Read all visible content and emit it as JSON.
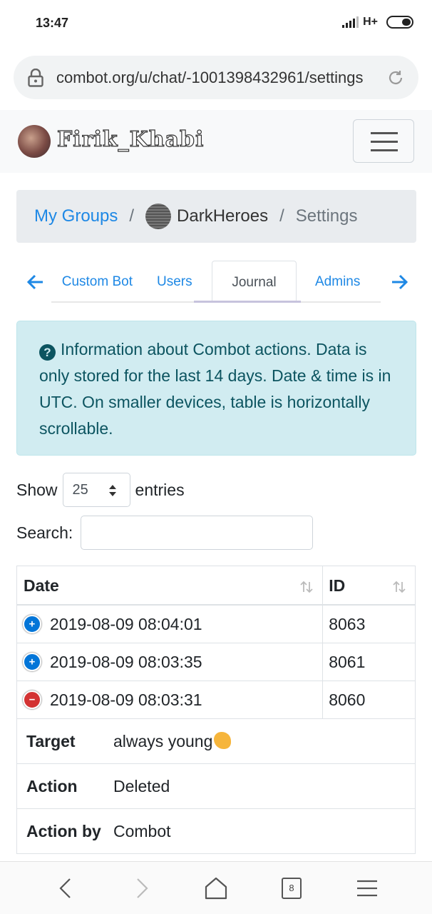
{
  "status_bar": {
    "time": "13:47",
    "network": "H+"
  },
  "browser": {
    "url": "combot.org/u/chat/-1001398432961/settings"
  },
  "navbar": {
    "username": "Firik_Khabi"
  },
  "breadcrumb": {
    "root": "My Groups",
    "separator": "/",
    "group": "DarkHeroes",
    "current": "Settings"
  },
  "tabs": {
    "items": [
      "Custom Bot",
      "Users",
      "Journal",
      "Admins"
    ],
    "active": "Journal"
  },
  "alert": {
    "text": "Information about Combot actions. Data is only stored for the last 14 days. Date & time is in UTC. On smaller devices, table is horizontally scrollable."
  },
  "controls": {
    "show_label": "Show",
    "entries_value": "25",
    "entries_label": "entries",
    "search_label": "Search:",
    "search_value": ""
  },
  "table": {
    "columns": [
      "Date",
      "ID"
    ],
    "rows": [
      {
        "date": "2019-08-09 08:04:01",
        "id": "8063",
        "expanded": false
      },
      {
        "date": "2019-08-09 08:03:35",
        "id": "8061",
        "expanded": false
      },
      {
        "date": "2019-08-09 08:03:31",
        "id": "8060",
        "expanded": true
      }
    ],
    "details": [
      {
        "label": "Target",
        "value": "always young"
      },
      {
        "label": "Action",
        "value": "Deleted"
      },
      {
        "label": "Action by",
        "value": "Combot"
      }
    ]
  },
  "bottom_nav": {
    "tab_count": "8"
  },
  "colors": {
    "link": "#1e88e5",
    "alert_bg": "#d1ecf1",
    "alert_text": "#0c5460",
    "expand": "#0275d8",
    "collapse": "#d33333"
  }
}
